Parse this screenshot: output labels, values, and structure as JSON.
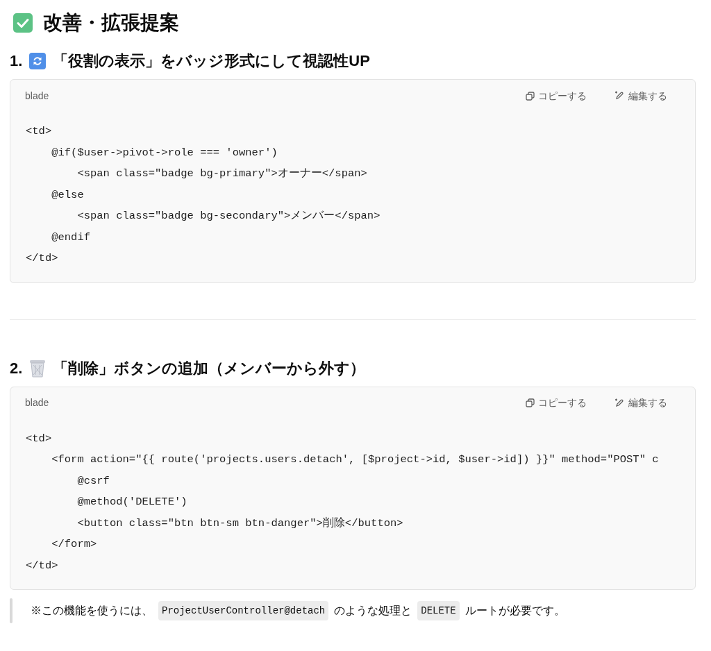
{
  "heading": {
    "text": "改善・拡張提案"
  },
  "sections": [
    {
      "number": "1.",
      "title": "「役割の表示」をバッジ形式にして視認性UP",
      "code": {
        "language": "blade",
        "copy_label": "コピーする",
        "edit_label": "編集する",
        "lines": [
          "<td>",
          "    @if($user->pivot->role === 'owner')",
          "        <span class=\"badge bg-primary\">オーナー</span>",
          "    @else",
          "        <span class=\"badge bg-secondary\">メンバー</span>",
          "    @endif",
          "</td>"
        ]
      }
    },
    {
      "number": "2.",
      "title": "「削除」ボタンの追加（メンバーから外す）",
      "code": {
        "language": "blade",
        "copy_label": "コピーする",
        "edit_label": "編集する",
        "lines": [
          "<td>",
          "    <form action=\"{{ route('projects.users.detach', [$project->id, $user->id]) }}\" method=\"POST\" c",
          "        @csrf",
          "        @method('DELETE')",
          "        <button class=\"btn btn-sm btn-danger\">削除</button>",
          "    </form>",
          "</td>"
        ]
      }
    }
  ],
  "note": [
    {
      "kind": "text",
      "text": "※この機能を使うには、"
    },
    {
      "kind": "code",
      "text": "ProjectUserController@detach"
    },
    {
      "kind": "text",
      "text": "のような処理と"
    },
    {
      "kind": "code",
      "text": "DELETE"
    },
    {
      "kind": "text",
      "text": "ルートが必要です。"
    }
  ]
}
